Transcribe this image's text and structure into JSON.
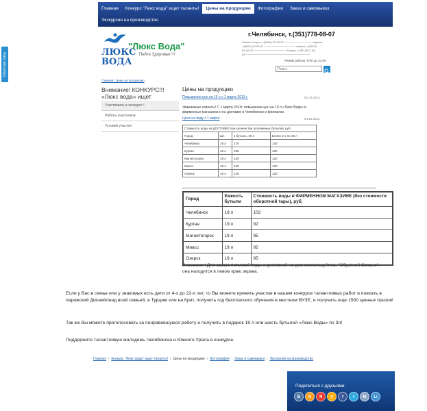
{
  "nav": {
    "items": [
      {
        "label": "Главная",
        "active": false
      },
      {
        "label": "Конкурс \"Люкс вода\" ищет таланты!",
        "active": false
      },
      {
        "label": "Цены на продукцию",
        "active": true
      },
      {
        "label": "Фотографии",
        "active": false
      },
      {
        "label": "Заказ и самовывоз",
        "active": false
      }
    ],
    "row2": [
      {
        "label": "Экскурсия на производство",
        "active": false
      }
    ]
  },
  "feedback_tab": "Обратная связь",
  "header": {
    "logo_line1": "ЛЮКС",
    "logo_line2": "ВОДА",
    "brand": "\"Люкс Вода\"",
    "tagline": "Пейте Здоровье !!!",
    "phone": "г.Челябинск, т.(351)778-08-07",
    "address_lines": [
      "г.Магнитогорск, т.(3519) 22-33-22 ────────────── г.Курган,",
      "т.(3522) 43-20-61 ──────────────── г.Миасс, т.(3513)",
      "50-02-02 ──────────────── г.Озерск, т.(35130) 2-38-",
      "63 ─────────────────────────────────"
    ],
    "hours": "Режим работы: 9:00 до 21:00",
    "search_placeholder": "Поиск"
  },
  "sidebar": {
    "breadcrumb": "Главная / Цены на продукцию",
    "title": "Внимание! КОНКУРС!!! «Люкс вода» ищет таланты!!!",
    "items": [
      {
        "label": "Участвовать в конкурсе !"
      },
      {
        "label": "Работы участников"
      },
      {
        "label": "Условия участия"
      }
    ]
  },
  "main": {
    "title": "Цены на продукцию",
    "news1": {
      "link": "Повышение цен на 19 л с 1 марта 2013 г.",
      "date": "01.02.2013",
      "text": "Уважаемые клиенты! С 1 марта 2013г. повышение цен на 19 л «Люкс Вода» в фирменных магазинах и на доставке в Челябинске и филиалах."
    },
    "news2": {
      "link": "Цена на воду с 1 марта",
      "date": "04.12.2012"
    },
    "delivery_table": {
      "caption": "Стоимость воды на ДОСТАВКЕ при количестве оплаченных бутылей, руб.",
      "headers": [
        "Город",
        "Шт.",
        "1 бутыль, 19 л",
        "Более 2-х по 19 л"
      ],
      "rows": [
        [
          "Челябинск",
          "19 л",
          "170",
          "140"
        ],
        [
          "Курган",
          "19 л",
          "155",
          "120"
        ],
        [
          "Магнитогорск",
          "19 л",
          "140",
          "120"
        ],
        [
          "Миасс",
          "19 л",
          "120",
          "120"
        ],
        [
          "Озерск",
          "19 л",
          "120",
          "120"
        ]
      ]
    },
    "store_table": {
      "headers": [
        "Город",
        "Емкость бутыли",
        "Стоимость воды в ФИРМЕННОМ МАГАЗИНЕ (без стоимости оборотной тары), руб."
      ],
      "rows": [
        [
          "Челябинск",
          "19 л",
          "102"
        ],
        [
          "Курган",
          "19 л",
          "92"
        ],
        [
          "Магнитогорск",
          "19 л",
          "95"
        ],
        [
          "Миасс",
          "19 л",
          "92"
        ],
        [
          "Озерск",
          "19 л",
          "95"
        ]
      ]
    },
    "attention": "Внимание ! Для заказа питьевой воды с доставкой на дом воспользуйтесь \"Обратной Связью\", она находится в левом краю экрана."
  },
  "paragraphs": [
    "Если у Вас в семье или у знакомых есть дети от 4-х до 22-х лет, то Вы можете принять участие в нашем конкурсе талантливых работ и поехать в парижский Диснейленд всей семьей, в Турцию или на Крит, получить год бесплатного обучения в местном ВУЗЕ, и получить еще 1500 ценных призов!",
    "Так же Вы можете проголосовать за понравившуюся работу и получить в подарок 19 л или шесть бутылей «Люкс Воды» по 3л!",
    "Поддержите талантливую молодежь Челябинска и Южного Урала в конкурсе."
  ],
  "footer": [
    {
      "label": "Главная",
      "link": true
    },
    {
      "label": "Конкурс \"Люкс вода\" ищет таланты!",
      "link": true
    },
    {
      "label": "Цены на продукцию",
      "link": false
    },
    {
      "label": "Фотографии",
      "link": true
    },
    {
      "label": "Заказ и самовывоз",
      "link": true
    },
    {
      "label": "Экскурсия на производство",
      "link": true
    }
  ],
  "share": {
    "title": "Поделиться с друзьями:",
    "icons": [
      {
        "name": "vkontakte-icon",
        "glyph": "В",
        "color": "#4c75a3"
      },
      {
        "name": "odnoklassniki-icon",
        "glyph": "О",
        "color": "#f59a1f"
      },
      {
        "name": "yandex-icon",
        "glyph": "Я",
        "color": "#e8392d"
      },
      {
        "name": "mailru-icon",
        "glyph": "@",
        "color": "#f7a600"
      },
      {
        "name": "facebook-icon",
        "glyph": "f",
        "color": "#3b5998"
      },
      {
        "name": "twitter-icon",
        "glyph": "t",
        "color": "#2aa9e0"
      },
      {
        "name": "moimir-icon",
        "glyph": "M",
        "color": "#8aa4c8"
      },
      {
        "name": "liveinternet-icon",
        "glyph": "Li",
        "color": "#3d8fd1"
      }
    ]
  }
}
